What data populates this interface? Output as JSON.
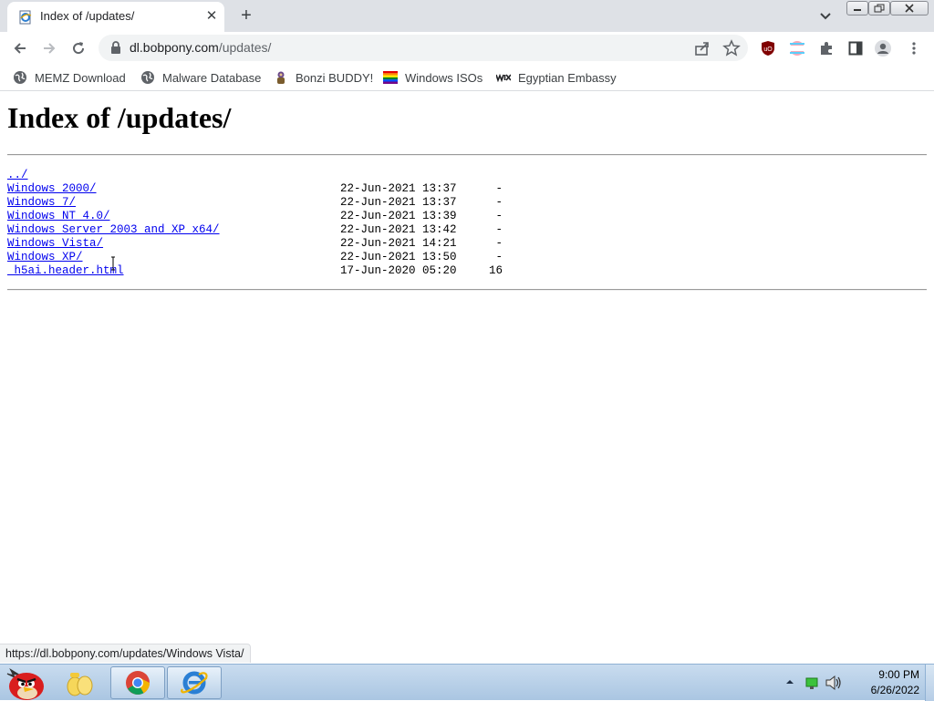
{
  "tab": {
    "title": "Index of /updates/",
    "favicon": "ie-page-icon",
    "close": "✕",
    "new_tab": "+"
  },
  "window_controls": {
    "minimize": "minimize-icon",
    "maximize": "restore-icon",
    "close": "close-icon"
  },
  "toolbar": {
    "url_host": "dl.bobpony.com",
    "url_path": "/updates/",
    "extensions": [
      "ublock-origin-icon",
      "pride-extension-icon",
      "puzzle-extensions-icon",
      "side-panel-icon",
      "profile-avatar-icon",
      "kebab-menu-icon"
    ]
  },
  "bookmarks": [
    {
      "label": "MEMZ Download",
      "icon": "globe-icon"
    },
    {
      "label": "Malware Database",
      "icon": "globe-icon"
    },
    {
      "label": "Bonzi BUDDY!",
      "icon": "bonzi-icon"
    },
    {
      "label": "Windows ISOs",
      "icon": "rainbow-flag-icon"
    },
    {
      "label": "Egyptian Embassy",
      "icon": "wix-icon"
    }
  ],
  "page": {
    "heading": "Index of /updates/",
    "entries": [
      {
        "name": "../",
        "date": "",
        "size": ""
      },
      {
        "name": "Windows 2000/",
        "date": "22-Jun-2021 13:37",
        "size": "-"
      },
      {
        "name": "Windows 7/",
        "date": "22-Jun-2021 13:37",
        "size": "-"
      },
      {
        "name": "Windows NT 4.0/",
        "date": "22-Jun-2021 13:39",
        "size": "-"
      },
      {
        "name": "Windows Server 2003 and XP x64/",
        "date": "22-Jun-2021 13:42",
        "size": "-"
      },
      {
        "name": "Windows Vista/",
        "date": "22-Jun-2021 14:21",
        "size": "-"
      },
      {
        "name": "Windows XP/",
        "date": "22-Jun-2021 13:50",
        "size": "-"
      },
      {
        "name": "_h5ai.header.html",
        "date": "17-Jun-2020 05:20",
        "size": "16"
      }
    ]
  },
  "status_bar": {
    "url": "https://dl.bobpony.com/updates/Windows Vista/"
  },
  "taskbar": {
    "apps": [
      "angry-birds-start-icon",
      "file-explorer-icon",
      "chrome-icon",
      "internet-explorer-icon"
    ],
    "clock_time": "9:00 PM",
    "clock_date": "6/26/2022"
  },
  "colors": {
    "link": "#0000ee",
    "tab_strip": "#dee1e6",
    "omnibox": "#f1f3f4",
    "taskbar": "#aac6e2"
  }
}
